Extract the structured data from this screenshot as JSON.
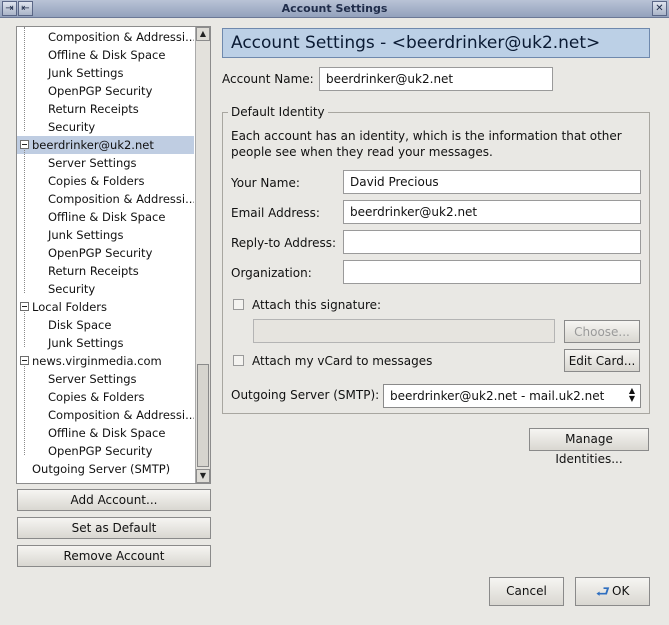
{
  "window": {
    "title": "Account Settings",
    "title_icon_left": "pin-icon",
    "title_icon_right": "window-close-icon"
  },
  "tree": {
    "rows": [
      {
        "label": "Composition & Addressi...",
        "level": 2
      },
      {
        "label": "Offline & Disk Space",
        "level": 2
      },
      {
        "label": "Junk Settings",
        "level": 2
      },
      {
        "label": "OpenPGP Security",
        "level": 2
      },
      {
        "label": "Return Receipts",
        "level": 2
      },
      {
        "label": "Security",
        "level": 2
      },
      {
        "label": "beerdrinker@uk2.net",
        "level": 1,
        "selected": true
      },
      {
        "label": "Server Settings",
        "level": 2
      },
      {
        "label": "Copies & Folders",
        "level": 2
      },
      {
        "label": "Composition & Addressi...",
        "level": 2
      },
      {
        "label": "Offline & Disk Space",
        "level": 2
      },
      {
        "label": "Junk Settings",
        "level": 2
      },
      {
        "label": "OpenPGP Security",
        "level": 2
      },
      {
        "label": "Return Receipts",
        "level": 2
      },
      {
        "label": "Security",
        "level": 2
      },
      {
        "label": "Local Folders",
        "level": 1
      },
      {
        "label": "Disk Space",
        "level": 2
      },
      {
        "label": "Junk Settings",
        "level": 2
      },
      {
        "label": "news.virginmedia.com",
        "level": 1
      },
      {
        "label": "Server Settings",
        "level": 2
      },
      {
        "label": "Copies & Folders",
        "level": 2
      },
      {
        "label": "Composition & Addressi...",
        "level": 2
      },
      {
        "label": "Offline & Disk Space",
        "level": 2
      },
      {
        "label": "OpenPGP Security",
        "level": 2
      },
      {
        "label": "Outgoing Server (SMTP)",
        "level": 1
      }
    ]
  },
  "left_buttons": {
    "add_account": "Add Account...",
    "set_default": "Set as Default",
    "remove_account": "Remove Account"
  },
  "main": {
    "header": "Account Settings - <beerdrinker@uk2.net>",
    "account_name_label": "Account Name:",
    "account_name_value": "beerdrinker@uk2.net",
    "default_identity_title": "Default Identity",
    "identity_description": "Each account has an identity, which is the information that other people see when they read your messages.",
    "your_name_label": "Your Name:",
    "your_name_value": "David Precious",
    "email_label": "Email Address:",
    "email_value": "beerdrinker@uk2.net",
    "reply_to_label": "Reply-to Address:",
    "reply_to_value": "",
    "organization_label": "Organization:",
    "organization_value": "",
    "attach_signature_label": "Attach this signature:",
    "signature_path_value": "",
    "choose_button": "Choose...",
    "attach_vcard_label": "Attach my vCard to messages",
    "edit_card_button": "Edit Card...",
    "outgoing_server_label": "Outgoing Server (SMTP):",
    "outgoing_server_value": "beerdrinker@uk2.net - mail.uk2.net",
    "manage_identities_button": "Manage Identities..."
  },
  "footer": {
    "cancel_button": "Cancel",
    "ok_button": "OK"
  }
}
